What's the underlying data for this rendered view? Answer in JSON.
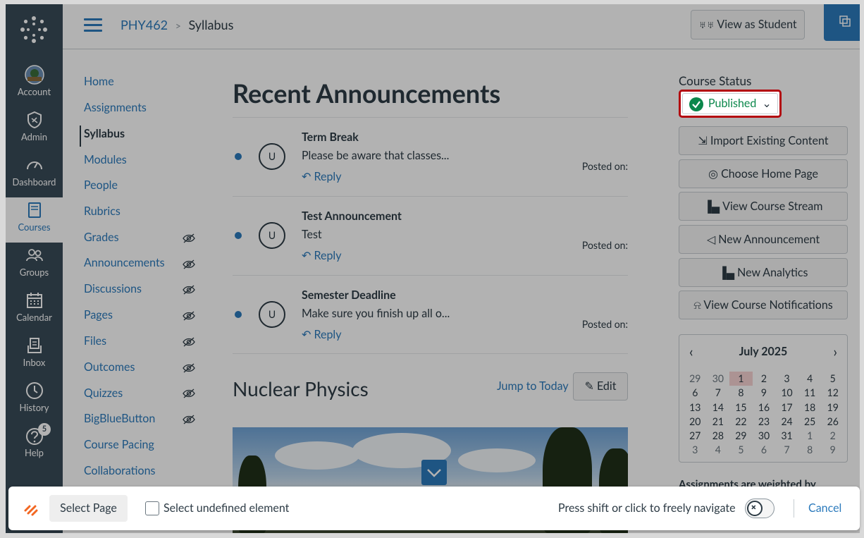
{
  "global_nav": {
    "items": [
      {
        "label": "Account",
        "icon": "avatar-icon"
      },
      {
        "label": "Admin",
        "icon": "admin-shield-icon"
      },
      {
        "label": "Dashboard",
        "icon": "dashboard-gauge-icon"
      },
      {
        "label": "Courses",
        "icon": "book-icon"
      },
      {
        "label": "Groups",
        "icon": "groups-icon"
      },
      {
        "label": "Calendar",
        "icon": "calendar-icon"
      },
      {
        "label": "Inbox",
        "icon": "inbox-icon"
      },
      {
        "label": "History",
        "icon": "clock-icon"
      },
      {
        "label": "Help",
        "icon": "help-icon",
        "badge": "5"
      }
    ]
  },
  "breadcrumb": {
    "course": "PHY462",
    "page": "Syllabus",
    "separator": ">"
  },
  "view_as_student": "View as Student",
  "course_nav": {
    "items": [
      {
        "label": "Home",
        "hidden": false
      },
      {
        "label": "Assignments",
        "hidden": false
      },
      {
        "label": "Syllabus",
        "hidden": false,
        "active": true
      },
      {
        "label": "Modules",
        "hidden": false
      },
      {
        "label": "People",
        "hidden": false
      },
      {
        "label": "Rubrics",
        "hidden": false
      },
      {
        "label": "Grades",
        "hidden": true
      },
      {
        "label": "Announcements",
        "hidden": true
      },
      {
        "label": "Discussions",
        "hidden": true
      },
      {
        "label": "Pages",
        "hidden": true
      },
      {
        "label": "Files",
        "hidden": true
      },
      {
        "label": "Outcomes",
        "hidden": true
      },
      {
        "label": "Quizzes",
        "hidden": true
      },
      {
        "label": "BigBlueButton",
        "hidden": true
      },
      {
        "label": "Course Pacing",
        "hidden": false
      },
      {
        "label": "Collaborations",
        "hidden": false
      }
    ]
  },
  "main": {
    "heading": "Recent Announcements",
    "announcements": [
      {
        "avatar": "U",
        "title": "Term Break",
        "message": "Please be aware that classes...",
        "reply": "Reply",
        "posted": "Posted on:"
      },
      {
        "avatar": "U",
        "title": "Test Announcement",
        "message": "Test",
        "reply": "Reply",
        "posted": "Posted on:"
      },
      {
        "avatar": "U",
        "title": "Semester Deadline",
        "message": "Make sure you finish up all o...",
        "reply": "Reply",
        "posted": "Posted on:"
      }
    ],
    "syllabus_heading": "Nuclear Physics",
    "jump_to_today": "Jump to Today",
    "edit": "Edit"
  },
  "sidebar": {
    "course_status_label": "Course Status",
    "status": "Published",
    "buttons": [
      {
        "label": "Import Existing Content",
        "icon": "import-icon"
      },
      {
        "label": "Choose Home Page",
        "icon": "target-icon"
      },
      {
        "label": "View Course Stream",
        "icon": "bar-chart-icon"
      },
      {
        "label": "New Announcement",
        "icon": "megaphone-icon"
      },
      {
        "label": "New Analytics",
        "icon": "bar-chart-icon"
      },
      {
        "label": "View Course Notifications",
        "icon": "bell-icon"
      }
    ],
    "calendar": {
      "month": "July 2025",
      "days": [
        {
          "d": "29",
          "o": true
        },
        {
          "d": "30",
          "o": true
        },
        {
          "d": "1",
          "t": true
        },
        {
          "d": "2"
        },
        {
          "d": "3"
        },
        {
          "d": "4"
        },
        {
          "d": "5"
        },
        {
          "d": "6"
        },
        {
          "d": "7"
        },
        {
          "d": "8"
        },
        {
          "d": "9"
        },
        {
          "d": "10"
        },
        {
          "d": "11"
        },
        {
          "d": "12"
        },
        {
          "d": "13"
        },
        {
          "d": "14"
        },
        {
          "d": "15"
        },
        {
          "d": "16"
        },
        {
          "d": "17"
        },
        {
          "d": "18"
        },
        {
          "d": "19"
        },
        {
          "d": "20"
        },
        {
          "d": "21"
        },
        {
          "d": "22"
        },
        {
          "d": "23"
        },
        {
          "d": "24"
        },
        {
          "d": "25"
        },
        {
          "d": "26"
        },
        {
          "d": "27"
        },
        {
          "d": "28"
        },
        {
          "d": "29"
        },
        {
          "d": "30"
        },
        {
          "d": "31"
        },
        {
          "d": "1",
          "o": true
        },
        {
          "d": "2",
          "o": true
        },
        {
          "d": "3",
          "o": true
        },
        {
          "d": "4",
          "o": true
        },
        {
          "d": "5",
          "o": true
        },
        {
          "d": "6",
          "o": true
        },
        {
          "d": "7",
          "o": true
        },
        {
          "d": "8",
          "o": true
        },
        {
          "d": "9",
          "o": true
        }
      ]
    },
    "weighted_text": "Assignments are weighted by"
  },
  "bottom_bar": {
    "select_page": "Select Page",
    "select_undefined": "Select undefined element",
    "press_shift": "Press shift or click to freely navigate",
    "cancel": "Cancel"
  },
  "colors": {
    "nav_bg": "#394b58",
    "link": "#2b7abc",
    "published": "#0b874b",
    "highlight": "#b3060e"
  }
}
